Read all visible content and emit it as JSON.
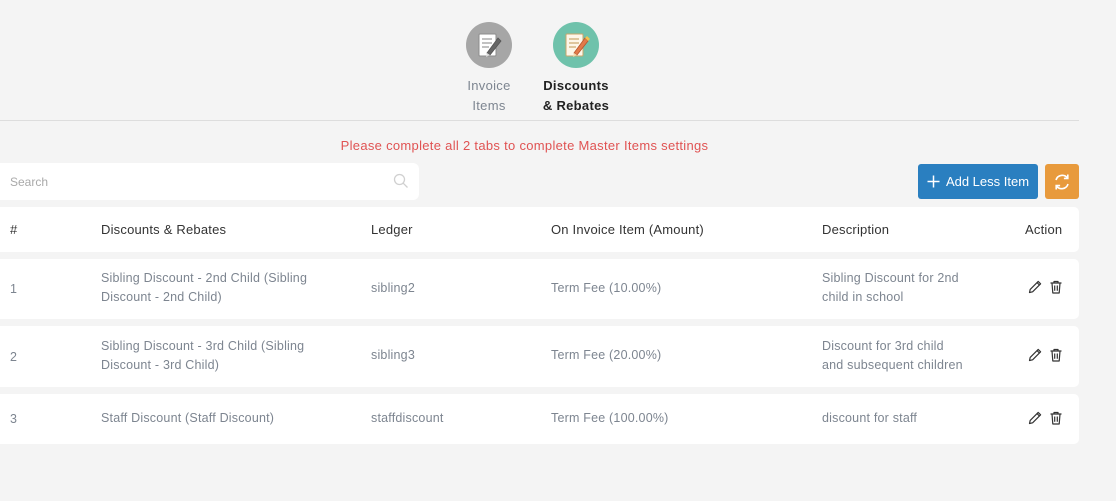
{
  "tabs": [
    {
      "line1": "Invoice",
      "line2": "Items",
      "icon": "edit-document-icon",
      "active": false
    },
    {
      "line1": "Discounts",
      "line2": "& Rebates",
      "icon": "edit-document-icon",
      "active": true
    }
  ],
  "warning": "Please complete all 2 tabs to complete Master Items settings",
  "search": {
    "placeholder": "Search",
    "value": "",
    "icon": "search-icon"
  },
  "toolbar": {
    "add_label": "Add Less Item",
    "add_icon": "plus-icon",
    "refresh_icon": "refresh-icon"
  },
  "table": {
    "headers": {
      "num": "#",
      "name": "Discounts & Rebates",
      "ledger": "Ledger",
      "amount": "On Invoice Item (Amount)",
      "description": "Description",
      "action": "Action"
    },
    "rows": [
      {
        "num": "1",
        "name_l1": "Sibling Discount - 2nd Child (Sibling",
        "name_l2": "Discount - 2nd Child)",
        "ledger": "sibling2",
        "amount": "Term Fee (10.00%)",
        "desc_l1": "Sibling Discount for 2nd",
        "desc_l2": "child in school"
      },
      {
        "num": "2",
        "name_l1": "Sibling Discount - 3rd Child (Sibling",
        "name_l2": "Discount - 3rd Child)",
        "ledger": "sibling3",
        "amount": "Term Fee (20.00%)",
        "desc_l1": "Discount for 3rd child",
        "desc_l2": "and subsequent children"
      },
      {
        "num": "3",
        "name_l1": "Staff Discount (Staff Discount)",
        "name_l2": "",
        "ledger": "staffdiscount",
        "amount": "Term Fee (100.00%)",
        "desc_l1": "discount for staff",
        "desc_l2": ""
      }
    ]
  },
  "colors": {
    "primary": "#2a7fc0",
    "refresh": "#e89a3c",
    "warning": "#e05353",
    "active_tab": "#6fc2ab",
    "inactive_tab": "#a6a6a6"
  }
}
